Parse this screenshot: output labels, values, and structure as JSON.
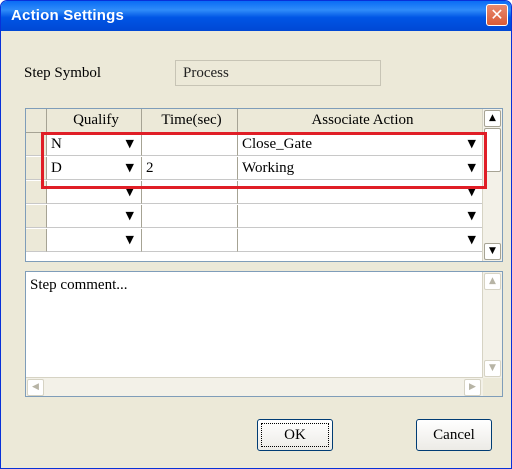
{
  "window": {
    "title": "Action Settings"
  },
  "step": {
    "symbol_label": "Step Symbol",
    "symbol_value": "Process"
  },
  "grid": {
    "columns": [
      "Qualify",
      "Time(sec)",
      "Associate Action"
    ],
    "rows": [
      {
        "qualify": "N",
        "time": "",
        "action": "Close_Gate"
      },
      {
        "qualify": "D",
        "time": "2",
        "action": "Working"
      },
      {
        "qualify": "",
        "time": "",
        "action": ""
      },
      {
        "qualify": "",
        "time": "",
        "action": ""
      },
      {
        "qualify": "",
        "time": "",
        "action": ""
      }
    ]
  },
  "comment": {
    "text": "Step comment..."
  },
  "buttons": {
    "ok": "OK",
    "cancel": "Cancel"
  },
  "icons": {
    "close": "close-icon",
    "dropdown": "chevron-down-icon"
  },
  "colors": {
    "title_bar": "#0055e5",
    "highlight": "#e01e26",
    "dialog_bg": "#ece9d8"
  }
}
